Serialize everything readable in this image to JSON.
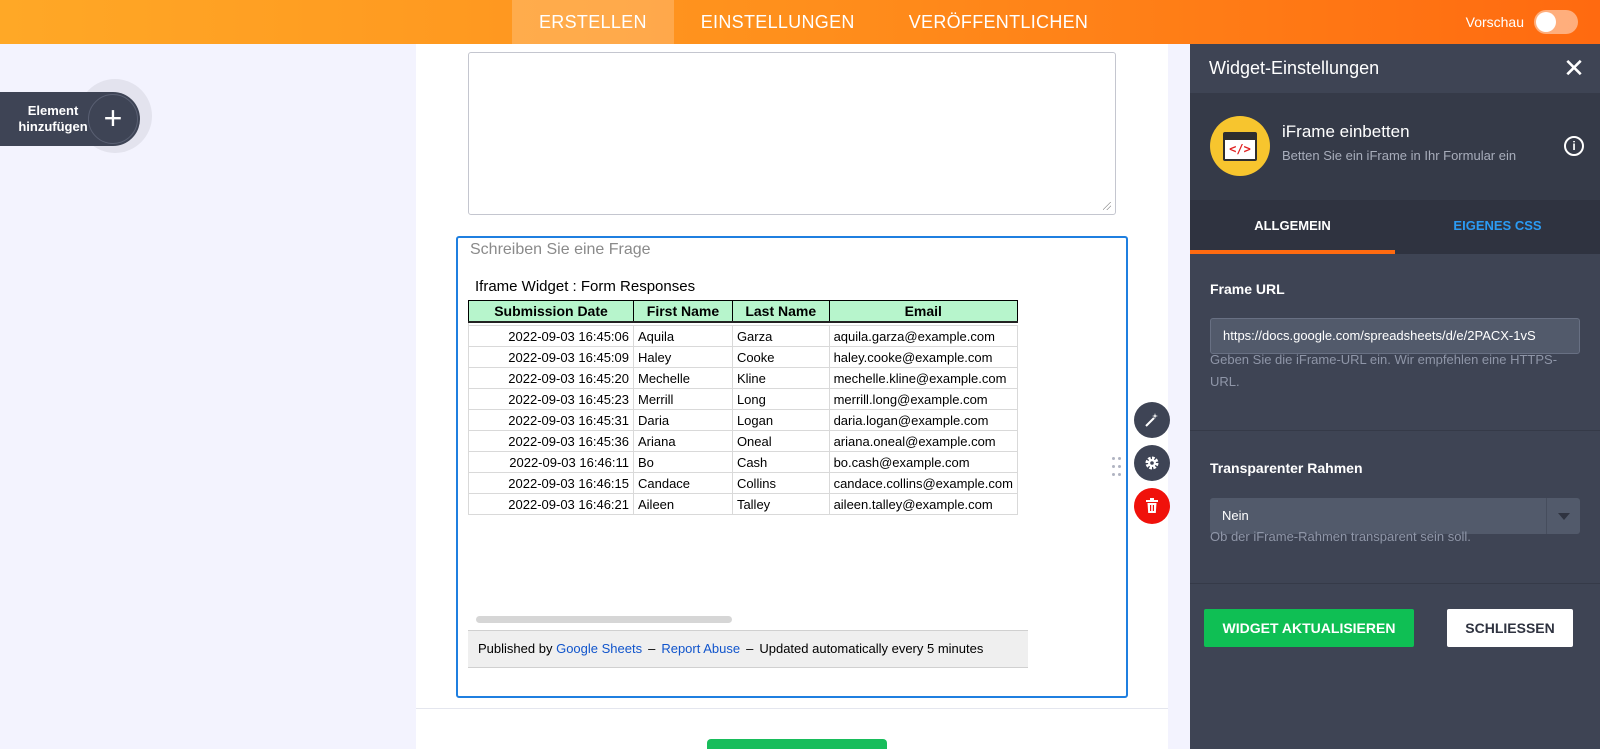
{
  "topbar": {
    "tabs": [
      {
        "label": "ERSTELLEN",
        "active": true
      },
      {
        "label": "EINSTELLUNGEN",
        "active": false
      },
      {
        "label": "VERÖFFENTLICHEN",
        "active": false
      }
    ],
    "preview_label": "Vorschau",
    "preview_enabled": false,
    "colors": {
      "gradient_start": "#ffa826",
      "gradient_end": "#ff6a10"
    }
  },
  "add_element": {
    "label": "Element hinzufügen",
    "icon": "plus-icon"
  },
  "form": {
    "question_placeholder": "Schreiben Sie eine Frage",
    "iframe": {
      "title": "Iframe Widget : Form Responses",
      "columns": [
        "Submission Date",
        "First Name",
        "Last Name",
        "Email"
      ],
      "rows": [
        [
          "2022-09-03 16:45:06",
          "Aquila",
          "Garza",
          "aquila.garza@example.com"
        ],
        [
          "2022-09-03 16:45:09",
          "Haley",
          "Cooke",
          "haley.cooke@example.com"
        ],
        [
          "2022-09-03 16:45:20",
          "Mechelle",
          "Kline",
          "mechelle.kline@example.com"
        ],
        [
          "2022-09-03 16:45:23",
          "Merrill",
          "Long",
          "merrill.long@example.com"
        ],
        [
          "2022-09-03 16:45:31",
          "Daria",
          "Logan",
          "daria.logan@example.com"
        ],
        [
          "2022-09-03 16:45:36",
          "Ariana",
          "Oneal",
          "ariana.oneal@example.com"
        ],
        [
          "2022-09-03 16:46:11",
          "Bo",
          "Cash",
          "bo.cash@example.com"
        ],
        [
          "2022-09-03 16:46:15",
          "Candace",
          "Collins",
          "candace.collins@example.com"
        ],
        [
          "2022-09-03 16:46:21",
          "Aileen",
          "Talley",
          "aileen.talley@example.com"
        ]
      ],
      "footer": {
        "published_by": "Published by",
        "google_sheets": "Google Sheets",
        "sep": "–",
        "report_abuse": "Report Abuse",
        "updated": "Updated automatically every 5 minutes"
      }
    },
    "tools": [
      "wand-icon",
      "gear-icon",
      "trash-icon"
    ]
  },
  "panel": {
    "title": "Widget-Einstellungen",
    "widget": {
      "name": "iFrame einbetten",
      "description": "Betten Sie ein iFrame in Ihr Formular ein",
      "icon_code": "</>"
    },
    "tabs": [
      {
        "label": "ALLGEMEIN",
        "active": true
      },
      {
        "label": "EIGENES CSS",
        "active": false
      }
    ],
    "frame_url": {
      "label": "Frame URL",
      "value": "https://docs.google.com/spreadsheets/d/e/2PACX-1vS",
      "help": "Geben Sie die iFrame-URL ein. Wir empfehlen eine HTTPS-URL."
    },
    "transparent_frame": {
      "label": "Transparenter Rahmen",
      "value": "Nein",
      "help": "Ob der iFrame-Rahmen transparent sein soll."
    },
    "buttons": {
      "update": "WIDGET AKTUALISIEREN",
      "close": "SCHLIESSEN"
    },
    "colors": {
      "panel": "#3e4454",
      "update": "#0fbf54",
      "accent": "#ff6a10",
      "link": "#2b9bf4"
    }
  }
}
